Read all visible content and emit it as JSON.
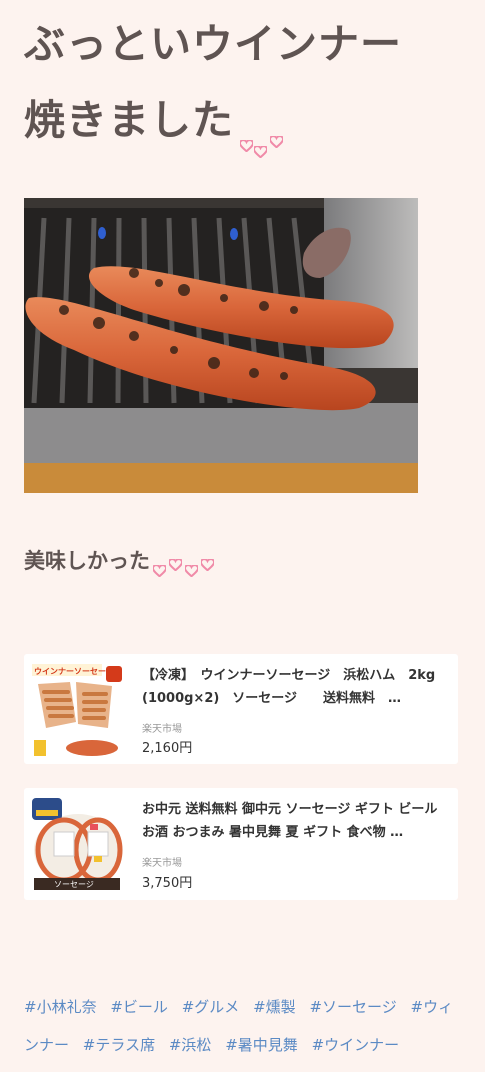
{
  "post": {
    "title_line1": "ぶっといウインナー",
    "title_line2": "焼きました",
    "subtext": "美味しかった"
  },
  "heart_color": "#f08aa8",
  "products": [
    {
      "title": "【冷凍】　ウインナーソーセージ　浜松ハム　2kg (1000g×2)　ソーセージ　　送料無料　…",
      "shop": "楽天市場",
      "price": "2,160円",
      "thumb_label": "ウインナーソーセージ"
    },
    {
      "title": "お中元 送料無料 御中元 ソーセージ ギフト ビール お酒 おつまみ 暑中見舞 夏 ギフト 食べ物 …",
      "shop": "楽天市場",
      "price": "3,750円",
      "thumb_label": "ソーセージ"
    }
  ],
  "tags": [
    "#小林礼奈",
    "#ビール",
    "#グルメ",
    "#燻製",
    "#ソーセージ",
    "#ウィンナー",
    "#テラス席",
    "#浜松",
    "#暑中見舞",
    "#ウインナー"
  ]
}
